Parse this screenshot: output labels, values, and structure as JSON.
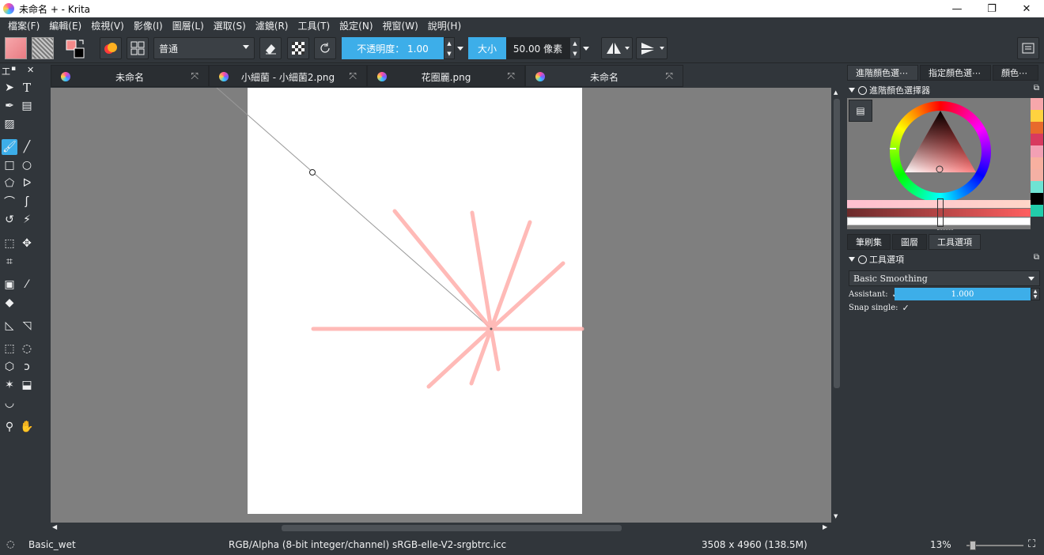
{
  "window": {
    "title": "未命名 + - Krita",
    "minimize": "—",
    "restore": "❐",
    "close": "✕"
  },
  "menu": [
    "檔案(F)",
    "編輯(E)",
    "檢視(V)",
    "影像(I)",
    "圖層(L)",
    "選取(S)",
    "濾鏡(R)",
    "工具(T)",
    "設定(N)",
    "視窗(W)",
    "說明(H)"
  ],
  "toolbar": {
    "blend_mode": "普通",
    "opacity_label": "不透明度： 1.00",
    "size_label": "大小",
    "size_value": "50.00 像素"
  },
  "toolbox": {
    "title": "工",
    "dots": "▪",
    "close": "✕"
  },
  "tabs": [
    {
      "label": "未命名"
    },
    {
      "label": "小細菌 - 小細菌2.png"
    },
    {
      "label": "花圈麗.png"
    },
    {
      "label": "未命名"
    }
  ],
  "right_panel": {
    "tabs": [
      "進階顏色選⋯",
      "指定顏色選⋯",
      "顏色⋯"
    ],
    "color_docker_title": "進階顏色選擇器",
    "lower_tabs": [
      "筆刷集",
      "圖層",
      "工具選項"
    ],
    "tool_options_title": "工具選項",
    "smoothing": "Basic Smoothing",
    "assistant_label": "Assistant:",
    "assistant_checked": "✓",
    "assistant_value": "1.000",
    "snap_single_label": "Snap single:",
    "snap_single_checked": "✓"
  },
  "colors": {
    "accent": "#3daee9",
    "background": "#31363b",
    "canvas_bg": "#7f7f7f",
    "stroke": "#ffb3b0",
    "history_swatches": [
      "#f7a7ab",
      "#ffd23f",
      "#e86a2c",
      "#d83a5f",
      "#f3a0b4",
      "#f8b0a0",
      "#f4b0a4",
      "#6fe3d3",
      "#000000",
      "#22ccaa"
    ]
  },
  "status": {
    "brush": "Basic_wet",
    "color_space": "RGB/Alpha (8-bit integer/channel)  sRGB-elle-V2-srgbtrc.icc",
    "image_size": "3508 x 4960 (138.5M)",
    "zoom": "13%"
  }
}
